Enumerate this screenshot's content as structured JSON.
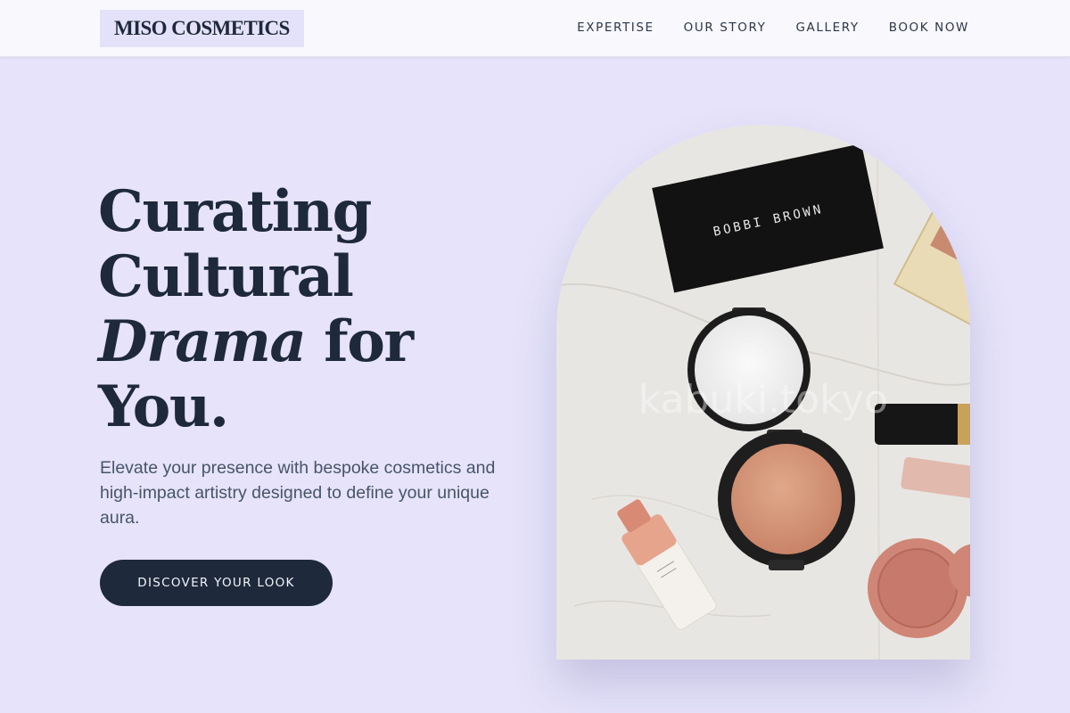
{
  "brand": {
    "name": "MISO COSMETICS"
  },
  "nav": {
    "items": [
      {
        "label": "EXPERTISE"
      },
      {
        "label": "OUR STORY"
      },
      {
        "label": "GALLERY"
      },
      {
        "label": "BOOK NOW"
      }
    ]
  },
  "hero": {
    "headline": {
      "line1": "Curating",
      "line2": "Cultural",
      "italic": "Drama",
      "after_italic": " for",
      "line4": "You."
    },
    "subtitle": "Elevate your presence with bespoke cosmetics and high-impact artistry designed to define your unique aura.",
    "cta_label": "DISCOVER YOUR LOOK",
    "image": {
      "palette_brand": "BOBBI BROWN",
      "watermark": "kabuki.tokyo"
    }
  },
  "colors": {
    "background": "#e6e3fa",
    "header_bg": "#f8f8fd",
    "logo_bg": "#e4e2fa",
    "primary_dark": "#1e293b",
    "body_text": "#475569"
  }
}
